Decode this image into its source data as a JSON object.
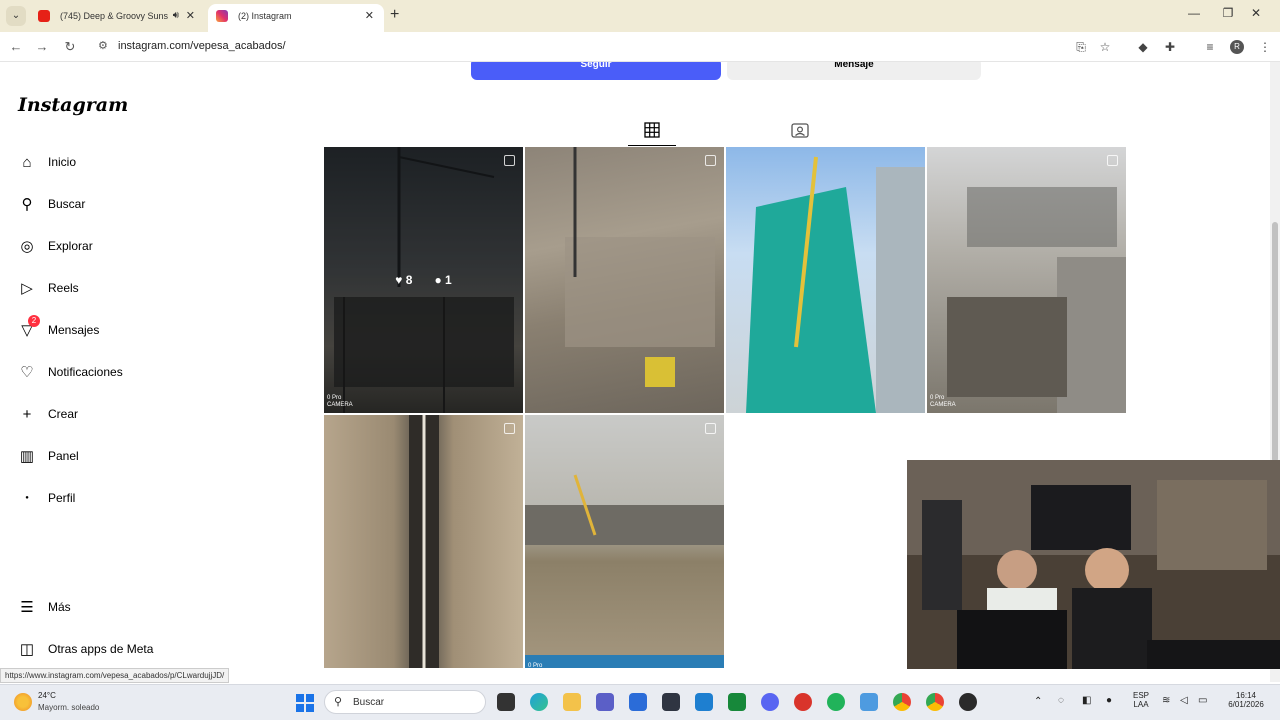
{
  "browser": {
    "tabs": [
      {
        "title": "(745) Deep & Groovy Suns",
        "active": false
      },
      {
        "title": "(2) Instagram",
        "active": true
      }
    ],
    "url": "instagram.com/vepesa_acabados/",
    "status_url": "https://www.instagram.com/vepesa_acabados/p/CLwardujjJD/"
  },
  "sidebar": {
    "logo": "Instagram",
    "items": [
      {
        "label": "Inicio",
        "icon": "home-icon"
      },
      {
        "label": "Buscar",
        "icon": "search-icon"
      },
      {
        "label": "Explorar",
        "icon": "compass-icon"
      },
      {
        "label": "Reels",
        "icon": "reels-icon"
      },
      {
        "label": "Mensajes",
        "icon": "messenger-icon",
        "badge": "2"
      },
      {
        "label": "Notificaciones",
        "icon": "heart-icon"
      },
      {
        "label": "Crear",
        "icon": "plus-icon"
      },
      {
        "label": "Panel",
        "icon": "chart-icon"
      },
      {
        "label": "Perfil",
        "icon": "avatar-icon"
      }
    ],
    "bottom_items": [
      {
        "label": "Más",
        "icon": "menu-icon"
      },
      {
        "label": "Otras apps de Meta",
        "icon": "apps-icon"
      }
    ]
  },
  "profile": {
    "follow_label": "Seguir",
    "message_label": "Mensaje"
  },
  "grid": {
    "hover_likes": "8",
    "hover_comments": "1",
    "camera_text": "0 Pro\nCAMERA"
  },
  "taskbar": {
    "temperature": "24°C",
    "weather": "Mayorm. soleado",
    "search_placeholder": "Buscar",
    "language": "ESP",
    "language_sub": "LAA",
    "time": "16:14",
    "date": "6/01/2026"
  }
}
